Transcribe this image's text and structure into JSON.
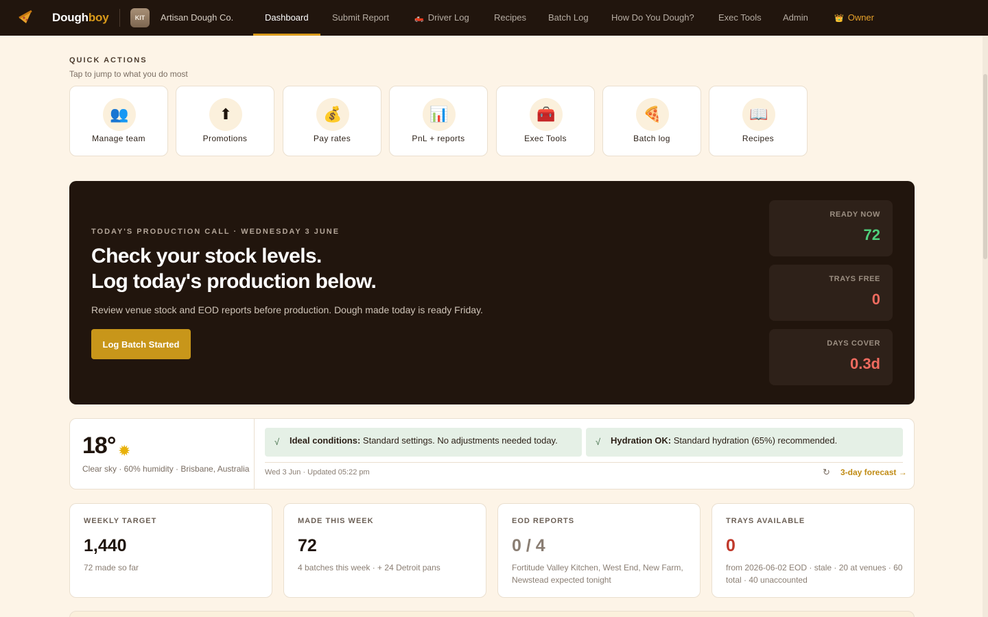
{
  "nav": {
    "brand_main": "Dough",
    "brand_accent": "boy",
    "org_badge": "KIT",
    "org_name": "Artisan Dough Co.",
    "items": [
      {
        "label": "Dashboard"
      },
      {
        "label": "Submit Report"
      },
      {
        "label": "Driver Log"
      },
      {
        "label": "Recipes"
      },
      {
        "label": "Batch Log"
      },
      {
        "label": "How Do You Dough?"
      },
      {
        "label": "Exec Tools"
      },
      {
        "label": "Admin"
      },
      {
        "label": "Owner"
      }
    ],
    "owner_icon": "👑",
    "driver_icon": "🛻"
  },
  "quick_actions": {
    "title": "QUICK ACTIONS",
    "subtitle": "Tap to jump to what you do most",
    "items": [
      {
        "label": "Manage team",
        "icon": "👥"
      },
      {
        "label": "Promotions",
        "icon": "⬆"
      },
      {
        "label": "Pay rates",
        "icon": "💰"
      },
      {
        "label": "PnL + reports",
        "icon": "📊"
      },
      {
        "label": "Exec Tools",
        "icon": "🧰"
      },
      {
        "label": "Batch log",
        "icon": "🍕"
      },
      {
        "label": "Recipes",
        "icon": "📖"
      }
    ]
  },
  "hero": {
    "kicker": "TODAY'S PRODUCTION CALL · WEDNESDAY 3 JUNE",
    "headline_1": "Check your stock levels.",
    "headline_2": "Log today's production below.",
    "description": "Review venue stock and EOD reports before production. Dough made today is ready Friday.",
    "button": "Log Batch Started",
    "stats": [
      {
        "label": "READY NOW",
        "value": "72",
        "color": "#4fcf7c"
      },
      {
        "label": "TRAYS FREE",
        "value": "0",
        "color": "#ef6b5f"
      },
      {
        "label": "DAYS COVER",
        "value": "0.3d",
        "color": "#ef6b5f"
      }
    ]
  },
  "weather": {
    "temp": "18°",
    "sun_icon": "✹",
    "meta": "Clear sky · 60% humidity · Brisbane, Australia",
    "tips": [
      {
        "title": "Ideal conditions:",
        "text": "Standard settings. No adjustments needed today."
      },
      {
        "title": "Hydration OK:",
        "text": "Standard hydration (65%) recommended."
      }
    ],
    "check_icon": "√",
    "updated": "Wed 3 Jun · Updated 05:22 pm",
    "refresh_icon": "↻",
    "forecast_link": "3-day forecast →"
  },
  "kpis": [
    {
      "label": "WEEKLY TARGET",
      "value": "1,440",
      "note": "72 made so far",
      "value_color": "#1f140c"
    },
    {
      "label": "MADE THIS WEEK",
      "value": "72",
      "note": "4 batches this week · + 24 Detroit pans",
      "value_color": "#1f140c"
    },
    {
      "label": "EOD REPORTS",
      "value": "0 / 4",
      "note": "Fortitude Valley Kitchen, West End, New Farm, Newstead expected tonight",
      "value_color": "#8a7e73"
    },
    {
      "label": "TRAYS AVAILABLE",
      "value": "0",
      "note": "from 2026-06-02 EOD · stale · 20 at venues · 60 total · 40 unaccounted",
      "value_color": "#c0392b"
    }
  ]
}
